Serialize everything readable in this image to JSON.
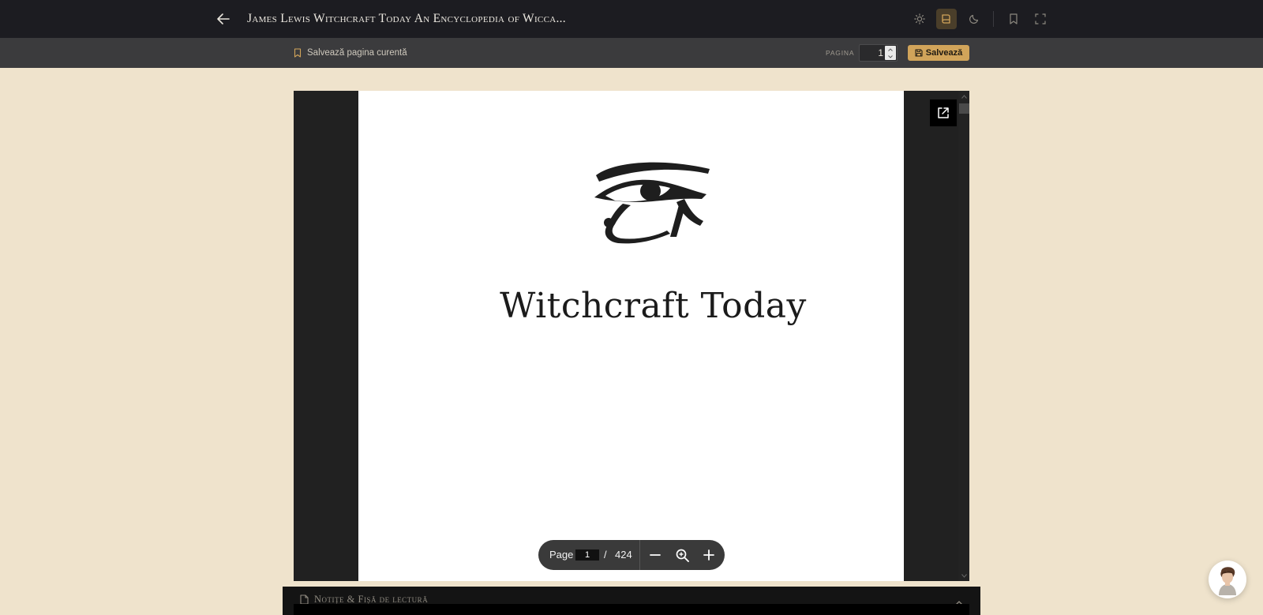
{
  "header": {
    "title": "James Lewis Witchcraft Today An Encyclopedia of Wicca...",
    "icons": [
      "arrow-left-icon",
      "sun-icon",
      "book-icon",
      "moon-icon",
      "bookmark-icon",
      "fullscreen-icon"
    ],
    "active_mode": "book-icon"
  },
  "subbar": {
    "save_current_label": "Salvează pagina curentă",
    "page_label": "PAGINA",
    "page_value": "1",
    "save_button_label": "Salvează"
  },
  "viewer": {
    "page_heading": "Witchcraft Today"
  },
  "pdf_toolbar": {
    "page_label": "Page",
    "current_page": "1",
    "separator": "/",
    "total_pages": "424"
  },
  "notes": {
    "title": "Notițe & Fișă de lectură"
  },
  "colors": {
    "background": "#efe3cc",
    "topbar": "#1c1c21",
    "subbar": "#3b3b3d",
    "accent": "#d1a45a",
    "viewer_dark": "#212121"
  }
}
